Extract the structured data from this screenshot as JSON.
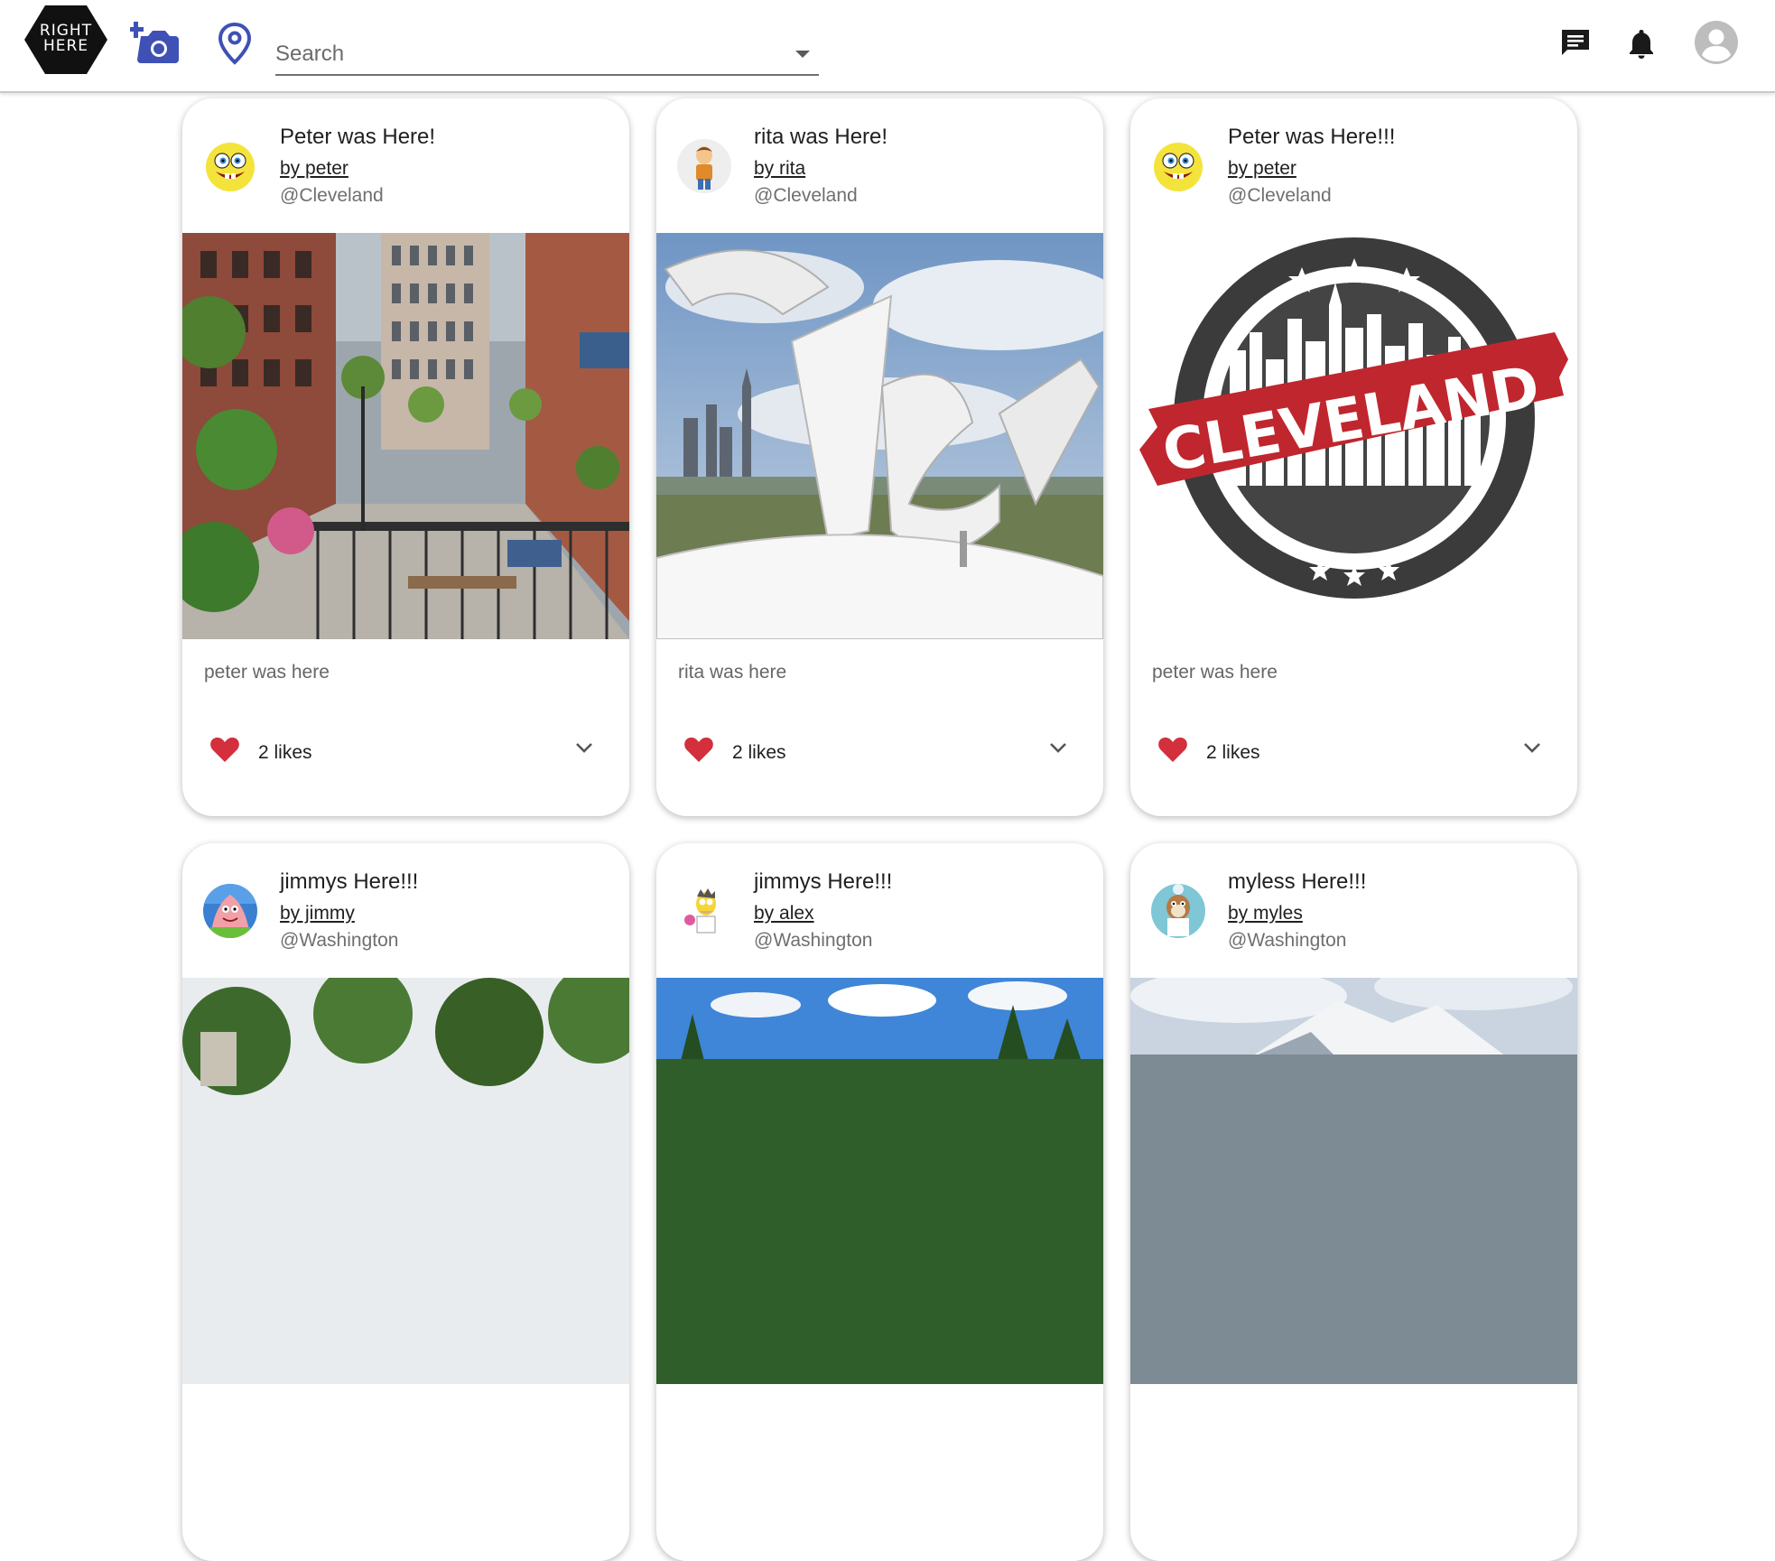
{
  "header": {
    "logo_text_line1": "RIGHT",
    "logo_text_line2": "HERE",
    "search": {
      "placeholder": "Search",
      "value": ""
    },
    "icons": {
      "add_photo": "add-a-photo-icon",
      "location": "location-pin-icon",
      "messages": "chat-icon",
      "notifications": "bell-icon",
      "account": "account-circle-icon"
    },
    "accent_color": "#3f51b5"
  },
  "posts": [
    {
      "title": "Peter was Here!",
      "author": "by peter",
      "location": "@Cleveland",
      "caption": "peter was here",
      "likes": "2 likes",
      "liked_color": "#d32f3c"
    },
    {
      "title": "rita was Here!",
      "author": "by rita",
      "location": "@Cleveland",
      "caption": "rita was here",
      "likes": "2 likes",
      "liked_color": "#d32f3c"
    },
    {
      "title": "Peter was Here!!!",
      "author": "by peter",
      "location": "@Cleveland",
      "caption": "peter was here",
      "likes": "2 likes",
      "liked_color": "#d32f3c",
      "image_word": "CLEVELAND"
    },
    {
      "title": "jimmys Here!!!",
      "author": "by jimmy",
      "location": "@Washington",
      "caption": "",
      "likes": ""
    },
    {
      "title": "jimmys Here!!!",
      "author": "by alex",
      "location": "@Washington",
      "caption": "",
      "likes": ""
    },
    {
      "title": "myless Here!!!",
      "author": "by myles",
      "location": "@Washington",
      "caption": "",
      "likes": ""
    }
  ]
}
